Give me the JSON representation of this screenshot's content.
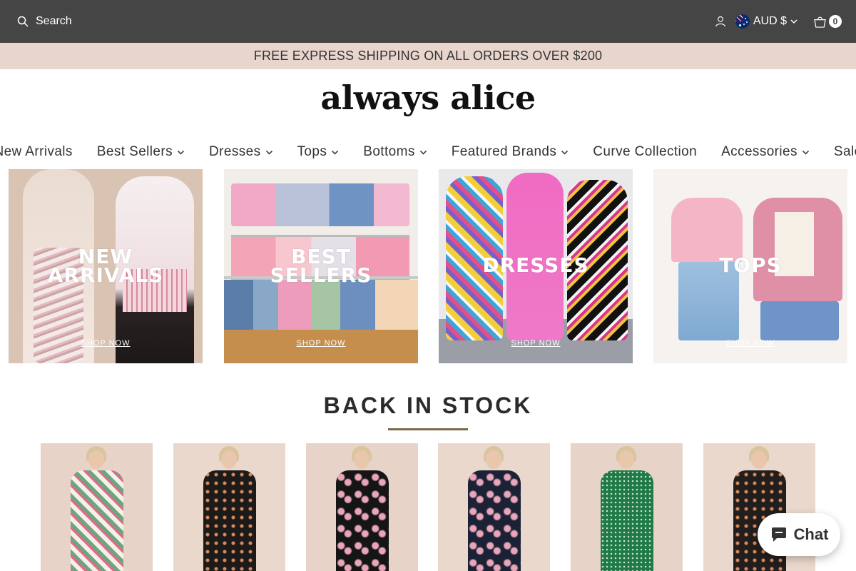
{
  "topbar": {
    "search_label": "Search",
    "currency_label": "AUD $",
    "cart_count": "0",
    "icons": [
      "search-icon",
      "account-icon",
      "australia-flag-icon",
      "chevron-down-icon",
      "cart-icon"
    ]
  },
  "announcement": "FREE EXPRESS SHIPPING ON ALL ORDERS OVER $200",
  "logo": "always alice",
  "nav": [
    {
      "label": "New Arrivals",
      "dropdown": false
    },
    {
      "label": "Best Sellers",
      "dropdown": true
    },
    {
      "label": "Dresses",
      "dropdown": true
    },
    {
      "label": "Tops",
      "dropdown": true
    },
    {
      "label": "Bottoms",
      "dropdown": true
    },
    {
      "label": "Featured Brands",
      "dropdown": true
    },
    {
      "label": "Curve Collection",
      "dropdown": false
    },
    {
      "label": "Accessories",
      "dropdown": true
    },
    {
      "label": "Sale",
      "dropdown": false
    }
  ],
  "tiles": [
    {
      "title_line1": "NEW",
      "title_line2": "ARRIVALS",
      "cta": "SHOP NOW"
    },
    {
      "title_line1": "BEST",
      "title_line2": "SELLERS",
      "cta": "SHOP NOW"
    },
    {
      "title_line1": "DRESSES",
      "title_line2": "",
      "cta": "SHOP NOW"
    },
    {
      "title_line1": "TOPS",
      "title_line2": "",
      "cta": "SHOP NOW"
    }
  ],
  "section": {
    "title": "BACK IN STOCK"
  },
  "products": [
    {
      "name": "floral-print-maxi-dress",
      "color": "#7fb08e"
    },
    {
      "name": "black-polka-dot-maxi-dress",
      "color": "#1d1a1a"
    },
    {
      "name": "black-floral-maxi-dress",
      "color": "#151515"
    },
    {
      "name": "navy-floral-maxi-dress",
      "color": "#1c2236"
    },
    {
      "name": "green-polka-dot-maxi-dress",
      "color": "#1f7a47"
    },
    {
      "name": "black-spot-tiered-maxi-dress",
      "color": "#221e1e"
    }
  ],
  "chat": {
    "label": "Chat",
    "accent": "#1f6fe5"
  },
  "colors": {
    "topbar": "#454545",
    "announcement": "#e8d6cd",
    "section_rule": "#7b6a4a"
  }
}
